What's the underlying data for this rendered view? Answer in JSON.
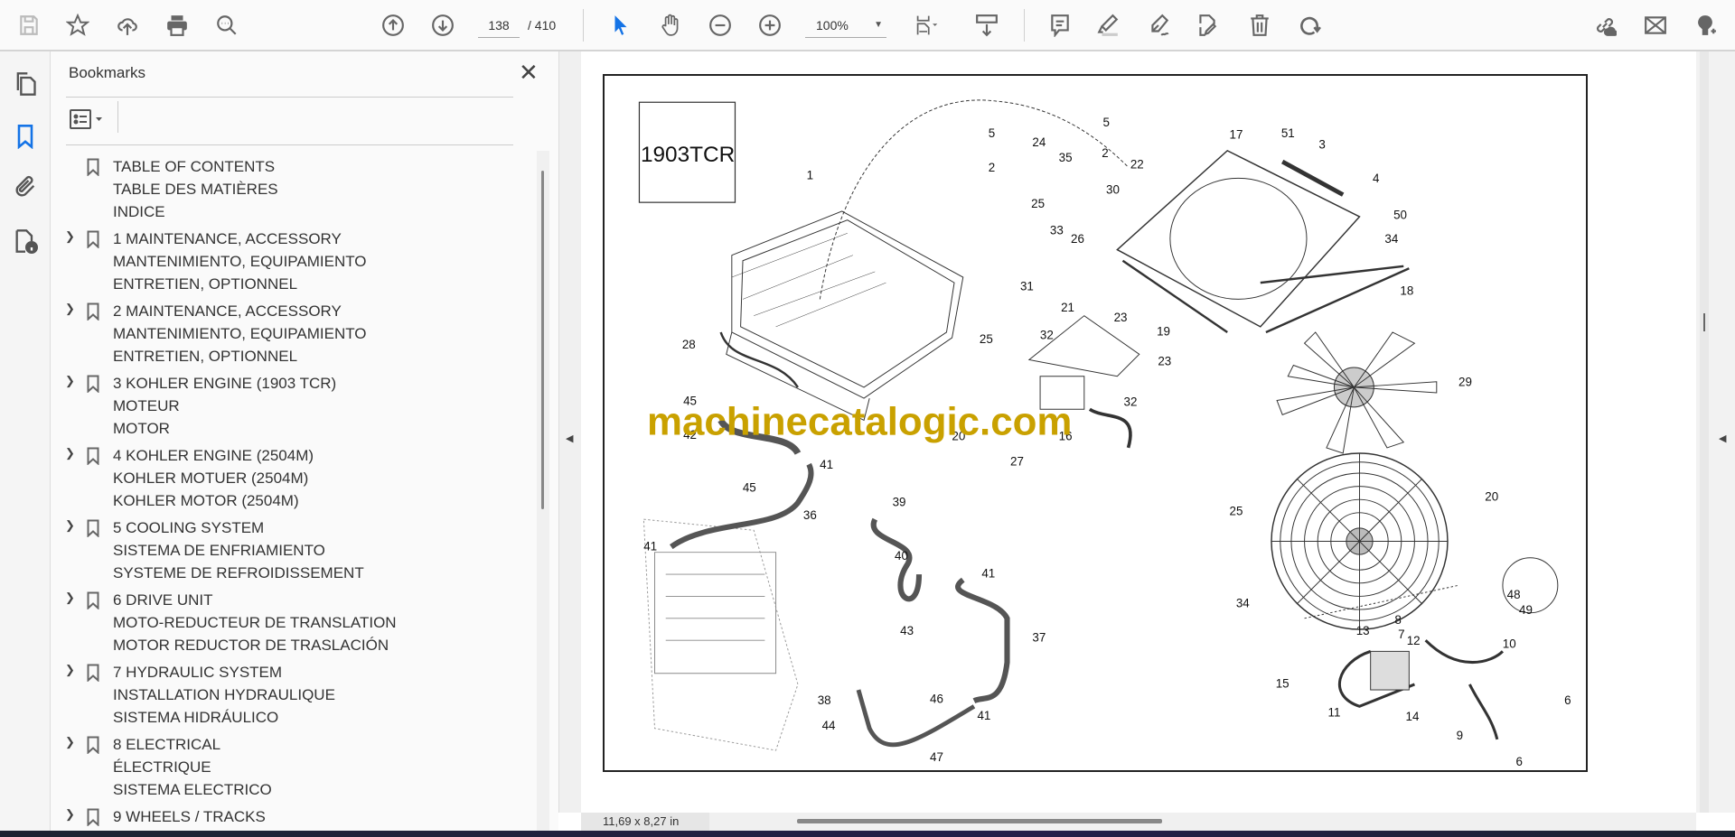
{
  "toolbar": {
    "page_current": "138",
    "page_total": "/ 410",
    "zoom": "100%",
    "accent": "#1473e6"
  },
  "bookmarks": {
    "title": "Bookmarks",
    "close": "✕",
    "items": [
      {
        "expandable": false,
        "lines": [
          "TABLE OF CONTENTS",
          "TABLE DES MATIÈRES",
          "INDICE"
        ]
      },
      {
        "expandable": true,
        "lines": [
          "1 MAINTENANCE, ACCESSORY",
          "MANTENIMIENTO, EQUIPAMIENTO",
          "ENTRETIEN, OPTIONNEL"
        ]
      },
      {
        "expandable": true,
        "lines": [
          "2 MAINTENANCE, ACCESSORY",
          "MANTENIMIENTO, EQUIPAMIENTO",
          "ENTRETIEN, OPTIONNEL"
        ]
      },
      {
        "expandable": true,
        "lines": [
          "3 KOHLER ENGINE (1903 TCR)",
          "MOTEUR",
          "MOTOR"
        ]
      },
      {
        "expandable": true,
        "lines": [
          "4 KOHLER ENGINE (2504M)",
          "KOHLER MOTUER (2504M)",
          "KOHLER MOTOR (2504M)"
        ]
      },
      {
        "expandable": true,
        "lines": [
          "5 COOLING SYSTEM",
          "SISTEMA DE ENFRIAMIENTO",
          "SYSTEME DE REFROIDISSEMENT"
        ]
      },
      {
        "expandable": true,
        "lines": [
          "6 DRIVE UNIT",
          "MOTO-REDUCTEUR DE TRANSLATION",
          "MOTOR REDUCTOR DE TRASLACIÓN"
        ]
      },
      {
        "expandable": true,
        "lines": [
          "7 HYDRAULIC SYSTEM",
          "INSTALLATION HYDRAULIQUE",
          "SISTEMA HIDRÁULICO"
        ]
      },
      {
        "expandable": true,
        "lines": [
          "8 ELECTRICAL",
          "ÉLECTRIQUE",
          "SISTEMA ELECTRICO"
        ]
      },
      {
        "expandable": true,
        "lines": [
          "9 WHEELS / TRACKS"
        ]
      }
    ]
  },
  "document": {
    "model_box": "1903TCR",
    "watermark": "machinecatalogic.com",
    "watermark_color": "#c9a100",
    "callouts": [
      "1",
      "5",
      "5",
      "24",
      "2",
      "2",
      "35",
      "22",
      "30",
      "25",
      "33",
      "26",
      "17",
      "51",
      "3",
      "4",
      "50",
      "34",
      "18",
      "19",
      "31",
      "21",
      "23",
      "23",
      "32",
      "32",
      "25",
      "28",
      "29",
      "45",
      "45",
      "42",
      "16",
      "27",
      "20",
      "41",
      "41",
      "41",
      "41",
      "36",
      "39",
      "40",
      "43",
      "37",
      "25",
      "20",
      "34",
      "48",
      "49",
      "8",
      "7",
      "12",
      "13",
      "10",
      "15",
      "11",
      "14",
      "6",
      "6",
      "9",
      "38",
      "46",
      "44",
      "47"
    ]
  },
  "status": {
    "page_size": "11,69 x 8,27 in"
  }
}
